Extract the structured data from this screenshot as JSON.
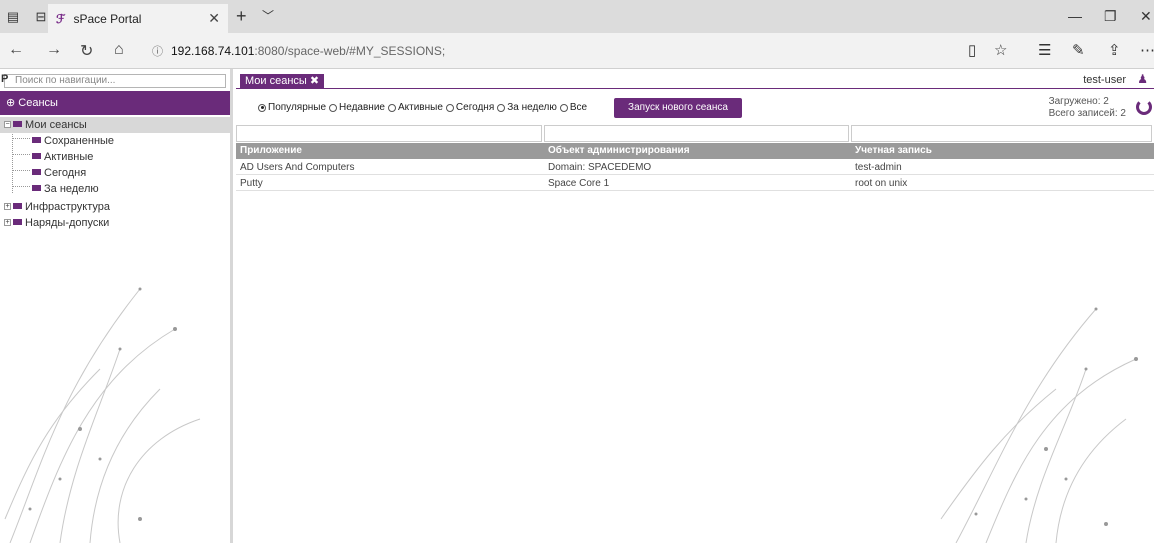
{
  "browser": {
    "tab_title": "sPace Portal",
    "url_host": "192.168.74.101",
    "url_path": ":8080/space-web/#MY_SESSIONS;"
  },
  "sidebar": {
    "search_placeholder": "Поиск по навигации...",
    "section_title": "Сеансы",
    "tree": {
      "root": "Мои сеансы",
      "children": [
        "Сохраненные",
        "Активные",
        "Сегодня",
        "За неделю"
      ],
      "others": [
        "Инфраструктура",
        "Наряды-допуски"
      ]
    }
  },
  "main": {
    "tab_label": "Мои сеансы",
    "username": "test-user",
    "filters": [
      "Популярные",
      "Недавние",
      "Активные",
      "Сегодня",
      "За неделю",
      "Все"
    ],
    "selected_filter": "Популярные",
    "launch_label": "Запуск нового сеанса",
    "loaded_text": "Загружено: 2",
    "total_text": "Всего записей: 2",
    "columns": [
      "Приложение",
      "Объект администрирования",
      "Учетная запись"
    ],
    "rows": [
      [
        "AD Users And Computers",
        "Domain: SPACEDEMO",
        "test-admin"
      ],
      [
        "Putty",
        "Space Core 1",
        "root on unix"
      ]
    ]
  },
  "colors": {
    "accent": "#6a2b7a",
    "header_gray": "#9a9a9a"
  }
}
